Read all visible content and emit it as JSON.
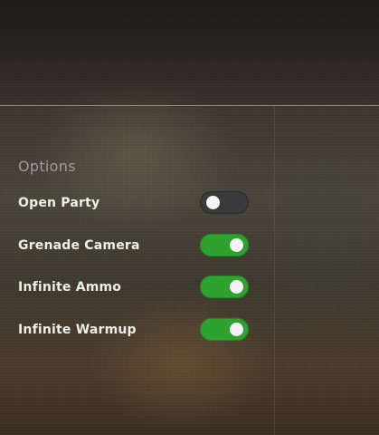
{
  "options": {
    "title": "Options",
    "items": [
      {
        "label": "Open Party",
        "enabled": false
      },
      {
        "label": "Grenade Camera",
        "enabled": true
      },
      {
        "label": "Infinite Ammo",
        "enabled": true
      },
      {
        "label": "Infinite Warmup",
        "enabled": true
      }
    ]
  },
  "colors": {
    "toggle_on": "#2fa12f",
    "toggle_off": "#3a3a3a",
    "knob": "#f4f4f4"
  }
}
